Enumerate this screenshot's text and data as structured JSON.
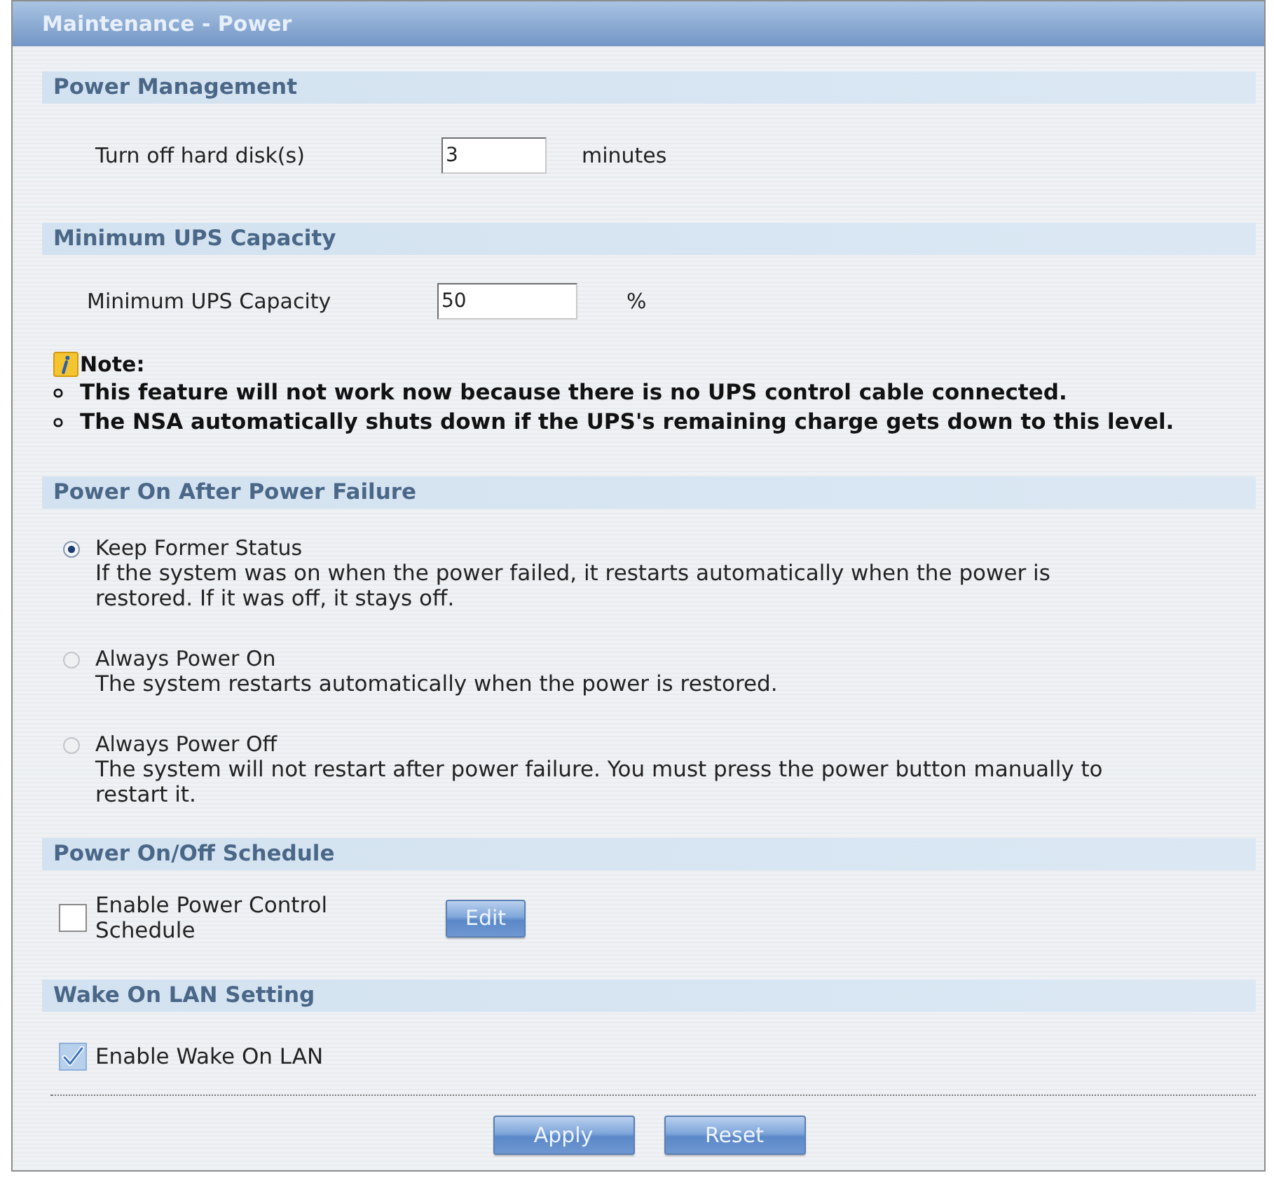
{
  "window": {
    "title": "Maintenance - Power"
  },
  "sections": [
    {
      "kind": "fields",
      "title": "Power Management",
      "fields": [
        {
          "label": "Turn off hard disk(s)",
          "value": "3",
          "unit": "minutes"
        }
      ]
    },
    {
      "kind": "fields",
      "title": "Minimum UPS Capacity",
      "fields": [
        {
          "label": "Minimum UPS Capacity",
          "value": "50",
          "unit": "%"
        }
      ],
      "note": {
        "title": "Note:",
        "items": [
          "This feature will not work now because there is no UPS control cable connected.",
          "The NSA automatically shuts down if the UPS's remaining charge gets down to this level."
        ]
      }
    },
    {
      "kind": "radios",
      "title": "Power On After Power Failure",
      "options": [
        {
          "label": "Keep Former Status",
          "description": "If the system was on when the power failed, it restarts automatically when the power is restored. If it was off, it stays off.",
          "selected": true
        },
        {
          "label": "Always Power On",
          "description": "The system restarts automatically when the power is restored.",
          "selected": false
        },
        {
          "label": "Always Power Off",
          "description": "The system will not restart after power failure. You must press the power button manually to restart it.",
          "selected": false
        }
      ]
    },
    {
      "kind": "checkbox",
      "title": "Power On/Off Schedule",
      "checkbox": {
        "label": "Enable Power Control Schedule",
        "checked": false
      },
      "button": "Edit"
    },
    {
      "kind": "checkbox",
      "title": "Wake On LAN Setting",
      "checkbox": {
        "label": "Enable Wake On LAN",
        "checked": true
      }
    }
  ],
  "buttons": [
    "Apply",
    "Reset"
  ]
}
